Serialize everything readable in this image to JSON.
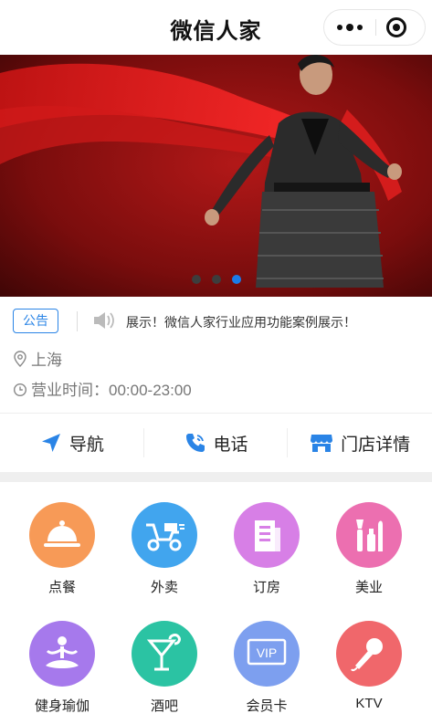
{
  "header": {
    "title": "微信人家"
  },
  "banner": {
    "dots": 3,
    "active_dot": 3
  },
  "notice": {
    "tag": "公告",
    "text": "展示！微信人家行业应用功能案例展示！"
  },
  "info": {
    "address": "上海",
    "hours": "营业时间：00:00-23:00"
  },
  "actions": [
    {
      "label": "导航",
      "icon": "navigation-arrow-icon"
    },
    {
      "label": "电话",
      "icon": "phone-icon"
    },
    {
      "label": "门店详情",
      "icon": "store-icon"
    }
  ],
  "services": [
    {
      "label": "点餐",
      "icon": "food-cloche-icon",
      "color": "#f79a57"
    },
    {
      "label": "外卖",
      "icon": "delivery-scooter-icon",
      "color": "#41a5ee"
    },
    {
      "label": "订房",
      "icon": "building-icon",
      "color": "#d77fe6"
    },
    {
      "label": "美业",
      "icon": "cosmetics-icon",
      "color": "#ec6fb0"
    },
    {
      "label": "健身瑜伽",
      "icon": "yoga-icon",
      "color": "#a679ec"
    },
    {
      "label": "酒吧",
      "icon": "cocktail-icon",
      "color": "#2bc3a3"
    },
    {
      "label": "会员卡",
      "icon": "vip-card-icon",
      "color": "#7d9fef"
    },
    {
      "label": "KTV",
      "icon": "microphone-icon",
      "color": "#f0676b"
    }
  ],
  "colors": {
    "accent": "#1a7ce8",
    "tag": "#2a84e6"
  }
}
